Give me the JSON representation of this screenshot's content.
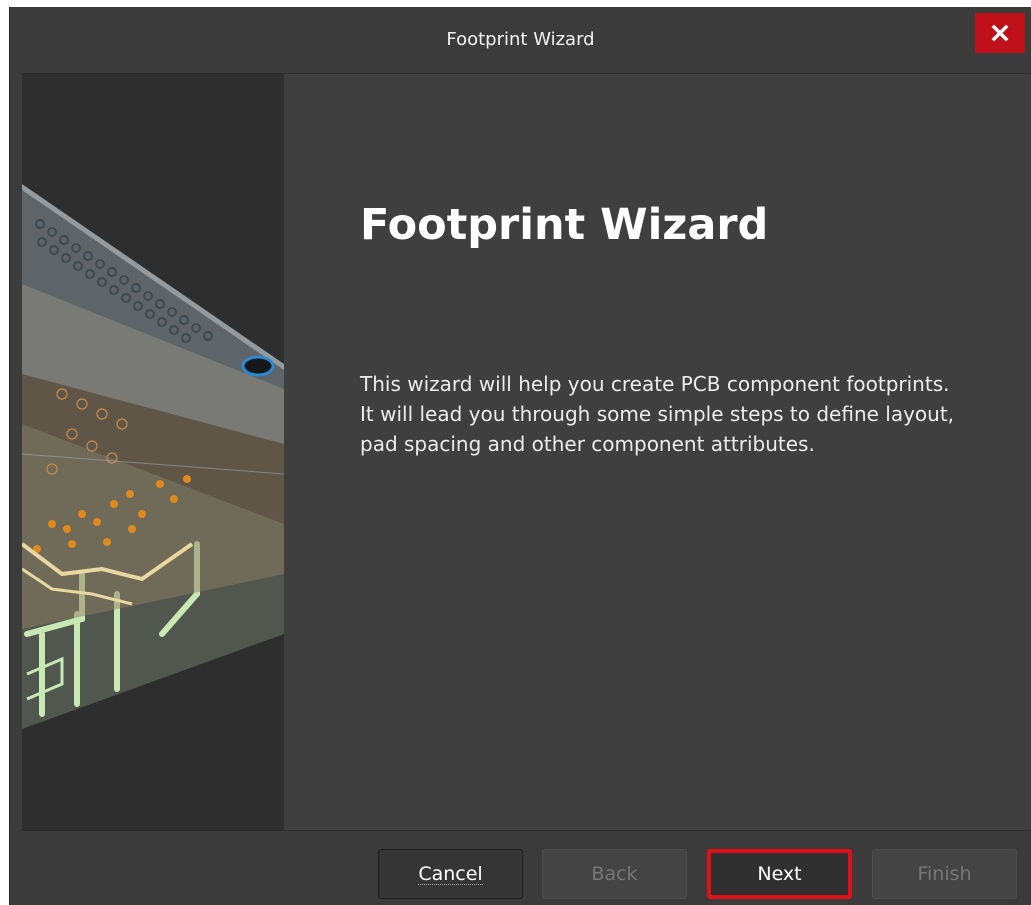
{
  "window": {
    "title": "Footprint Wizard",
    "close_icon": "close-icon"
  },
  "main": {
    "heading": "Footprint Wizard",
    "description_lines": [
      "This wizard will help you create PCB component footprints.",
      "It will lead you through some simple steps to define layout, pad spacing and other component attributes."
    ]
  },
  "side_panel": {
    "image": "pcb-layers-illustration"
  },
  "footer": {
    "buttons": {
      "cancel": "Cancel",
      "back": "Back",
      "next": "Next",
      "finish": "Finish"
    }
  },
  "colors": {
    "close_button": "#c0111a",
    "highlight_border": "#e0101a",
    "background": "#3f3f3f",
    "side_panel": "#2e2e2e"
  }
}
